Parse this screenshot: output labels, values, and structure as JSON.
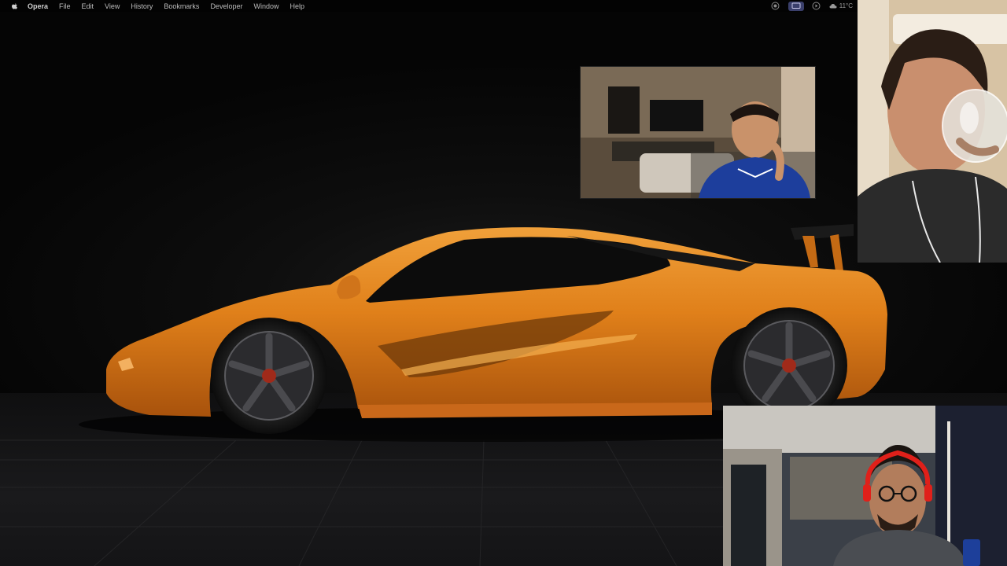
{
  "menubar": {
    "apple_icon": "apple-icon",
    "app_name": "Opera",
    "items": [
      "File",
      "Edit",
      "View",
      "History",
      "Bookmarks",
      "Developer",
      "Window",
      "Help"
    ],
    "status": {
      "icons": [
        "record-icon",
        "screen-share-icon",
        "media-play-icon"
      ],
      "weather_icon": "cloud-icon",
      "temperature": "11°C"
    }
  },
  "desktop": {
    "wallpaper": "orange supercar on dark showroom floor",
    "car_color": "#e0801a",
    "background_color": "#0b0b0b"
  },
  "video_tiles": [
    {
      "participant": "participant-1",
      "scene": "living room, blue shirt"
    },
    {
      "participant": "participant-2",
      "scene": "drinking from glass, earphones"
    },
    {
      "participant": "participant-3",
      "scene": "glasses, red headphones"
    }
  ]
}
